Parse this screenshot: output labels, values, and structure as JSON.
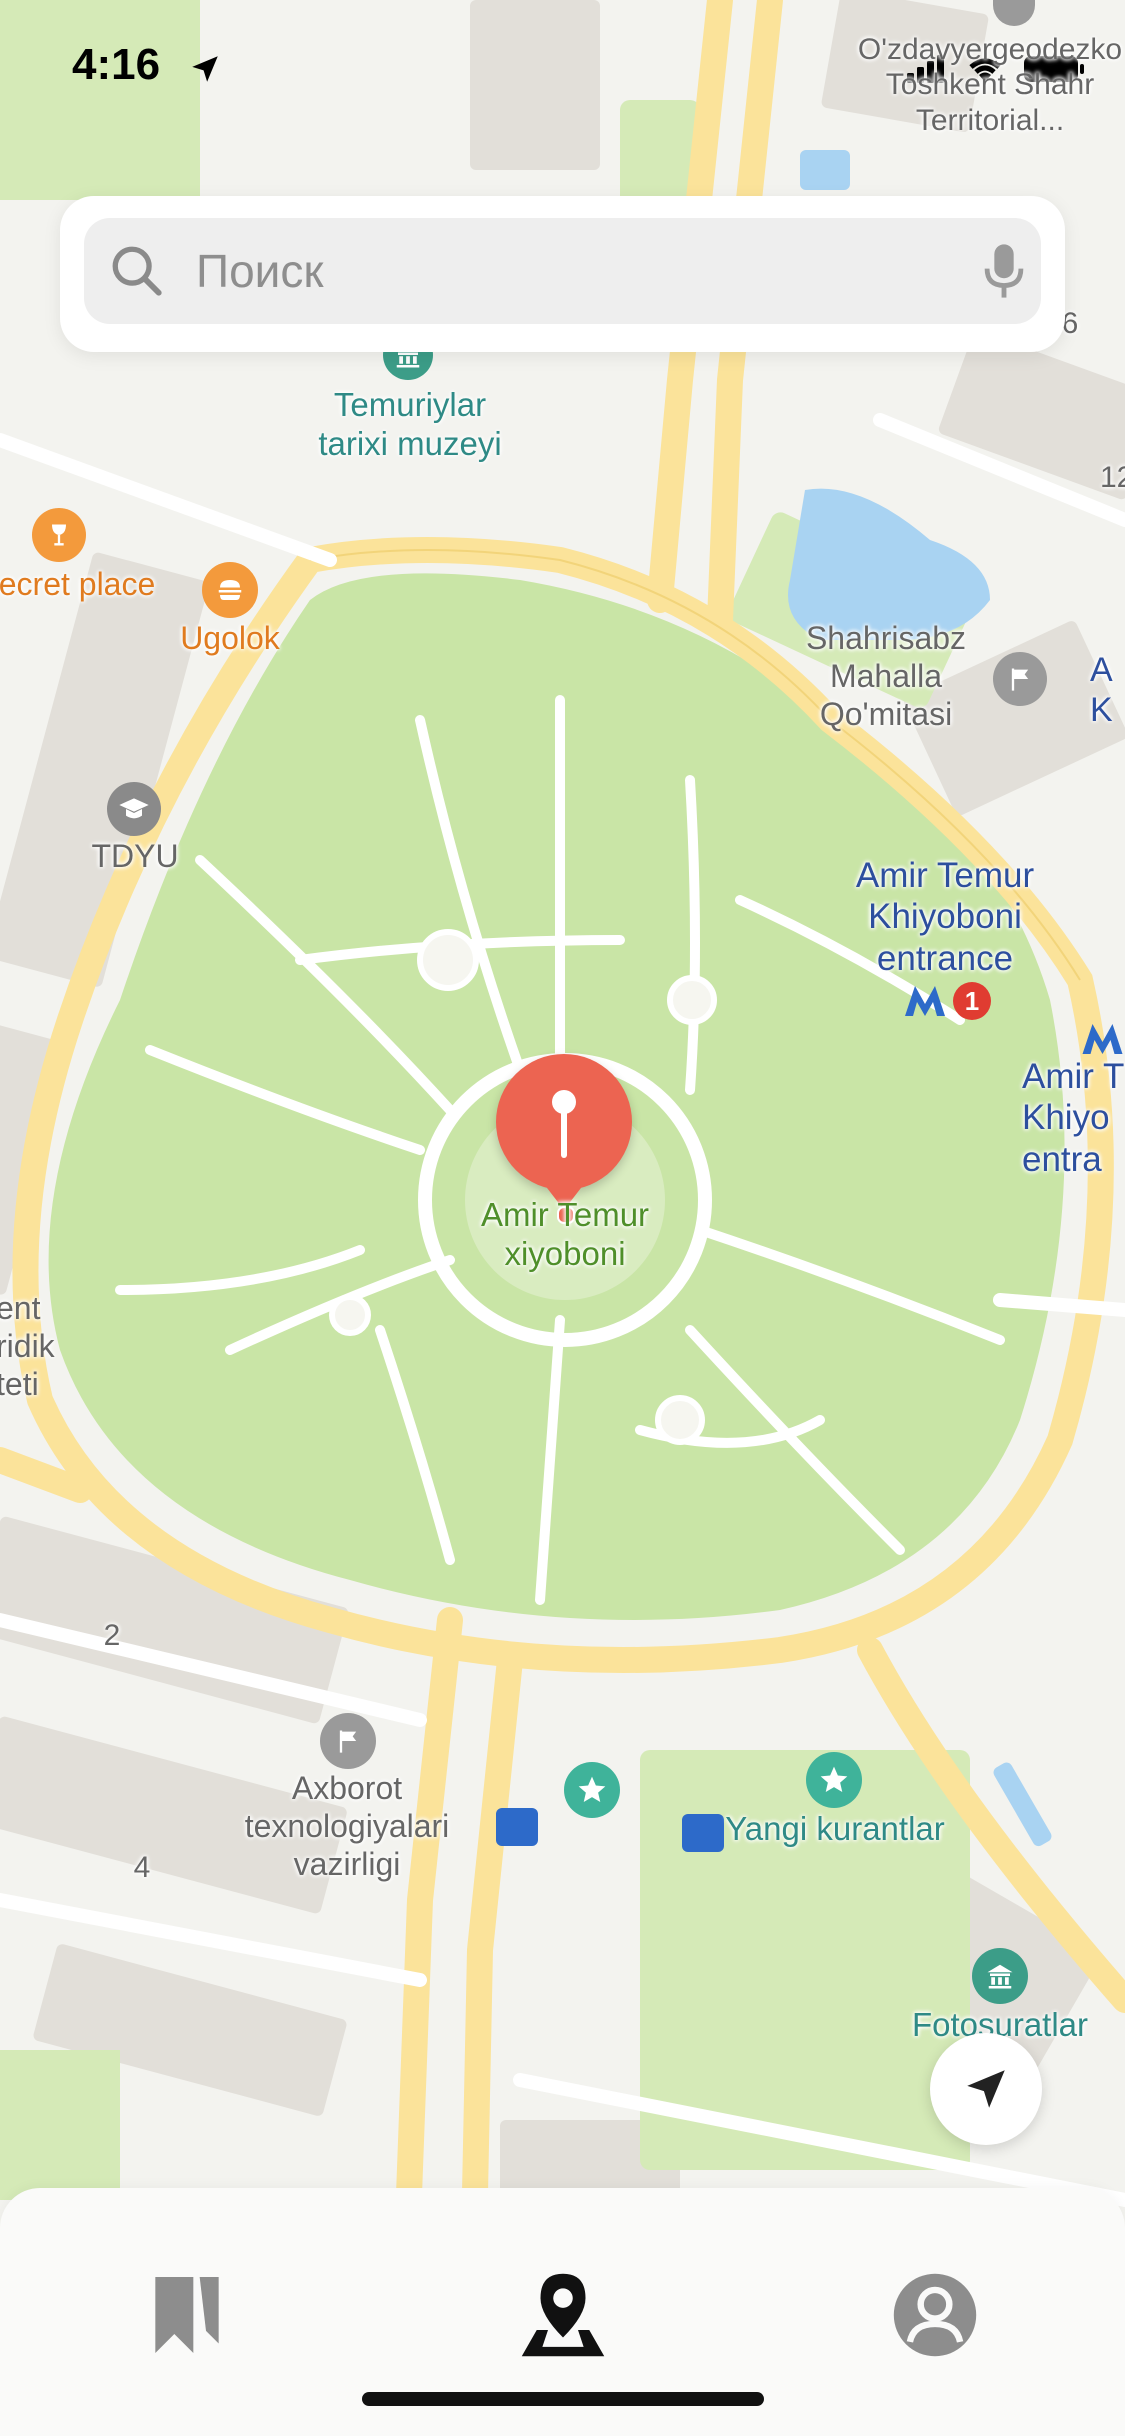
{
  "status_bar": {
    "time": "4:16"
  },
  "search": {
    "placeholder": "Поиск"
  },
  "map": {
    "labels": {
      "museum": "Temuriylar\ntarixi muzeyi",
      "secret_place": "ecret place",
      "ugolok": "Ugolok",
      "tdyu": "TDYU",
      "mahalla": "Shahrisabz\nMahalla\nQo'mitasi",
      "metro_entrance": "Amir Temur\nKhiyoboni\nentrance",
      "metro_entrance_2": "Amir T\nKhiyo\nentra",
      "metro_number": "1",
      "park": "Amir Temur\nxiyoboni",
      "left_edge": "ent\nridik\nteti",
      "ministry": "Axborot\ntexnologiyalari\nvazirligi",
      "yangi_kurantlar": "Yangi kurantlar",
      "fotosuratlar": "Fotosuratlar",
      "top_right": "O'zdavyergeodezko\nToshkent Shahr\nTerritorial...",
      "house_2": "2",
      "house_4": "4",
      "house_6": "6",
      "house_12": "12",
      "edge_a": "A\nK"
    }
  },
  "colors": {
    "park": "#c9e5a6",
    "park_light": "#d9ecc0",
    "road_major": "#fbe39a",
    "road_minor": "#ffffff",
    "building": "#e2dfd9",
    "water": "#a9d3f2",
    "pin": "#ec6451",
    "metro": "#2d6ac9",
    "metro_line_badge": "#e03c31"
  },
  "icons": {
    "search": "search-icon",
    "mic": "microphone-icon",
    "bookmarks": "bookmark-icon",
    "map": "map-pin-icon",
    "profile": "profile-icon",
    "locate": "navigation-arrow-icon"
  }
}
